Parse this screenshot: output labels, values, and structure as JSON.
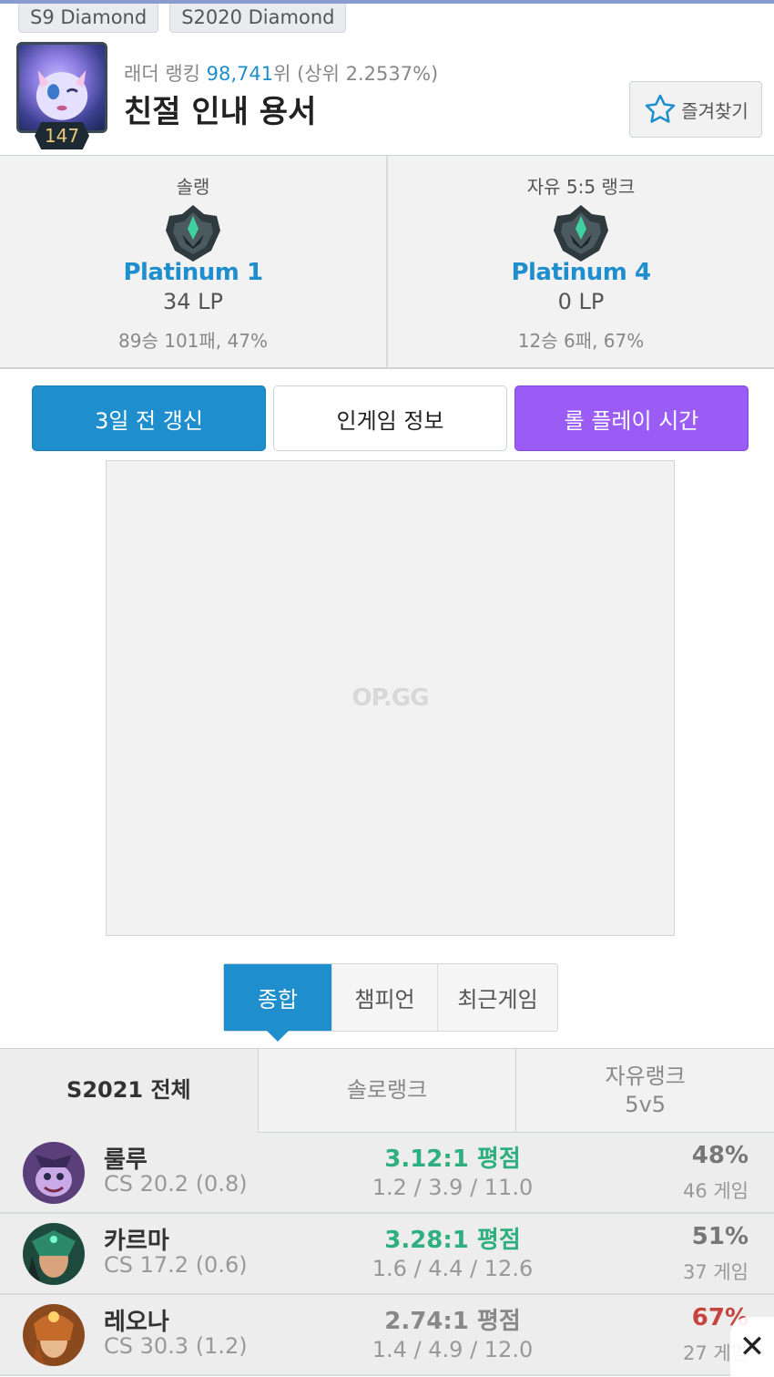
{
  "seasons": [
    "S9 Diamond",
    "S2020 Diamond"
  ],
  "profile": {
    "level": "147",
    "ladder_prefix": "래더 랭킹 ",
    "ladder_rank": "98,741",
    "ladder_suffix": "위 (상위 2.2537%)",
    "name": "친절 인내 용서",
    "favorite_label": "즐겨찾기"
  },
  "ranks": [
    {
      "title": "솔랭",
      "tier": "Platinum 1",
      "lp": "34 LP",
      "record": "89승 101패, 47%"
    },
    {
      "title": "자유 5:5 랭크",
      "tier": "Platinum 4",
      "lp": "0 LP",
      "record": "12승 6패, 67%"
    }
  ],
  "actions": {
    "renew": "3일 전 갱신",
    "ingame": "인게임 정보",
    "playtime": "롤 플레이 시간"
  },
  "ad": {
    "logo": "OP.GG"
  },
  "tabs": [
    "종합",
    "챔피언",
    "최근게임"
  ],
  "queue_tabs": {
    "all": "S2021 전체",
    "solo": "솔로랭크",
    "flex_line1": "자유랭크",
    "flex_line2": "5v5"
  },
  "champions": [
    {
      "name": "룰루",
      "cs": "CS 20.2 (0.8)",
      "ratio": "3.12:1 평점",
      "kda": "1.2 / 3.9 / 11.0",
      "winrate": "48%",
      "games": "46 게임",
      "ratio_color": "#2daf7f",
      "winrate_color": "#777777"
    },
    {
      "name": "카르마",
      "cs": "CS 17.2 (0.6)",
      "ratio": "3.28:1 평점",
      "kda": "1.6 / 4.4 / 12.6",
      "winrate": "51%",
      "games": "37 게임",
      "ratio_color": "#2daf7f",
      "winrate_color": "#777777"
    },
    {
      "name": "레오나",
      "cs": "CS 30.3 (1.2)",
      "ratio": "2.74:1 평점",
      "kda": "1.4 / 4.9 / 12.0",
      "winrate": "67%",
      "games": "27 게임",
      "ratio_color": "#888888",
      "winrate_color": "#c6443e"
    }
  ],
  "colors": {
    "accent": "#1f8ecd",
    "purple": "#9b5cf6",
    "good": "#2daf7f",
    "bad": "#c6443e"
  },
  "close_icon": "close-icon"
}
